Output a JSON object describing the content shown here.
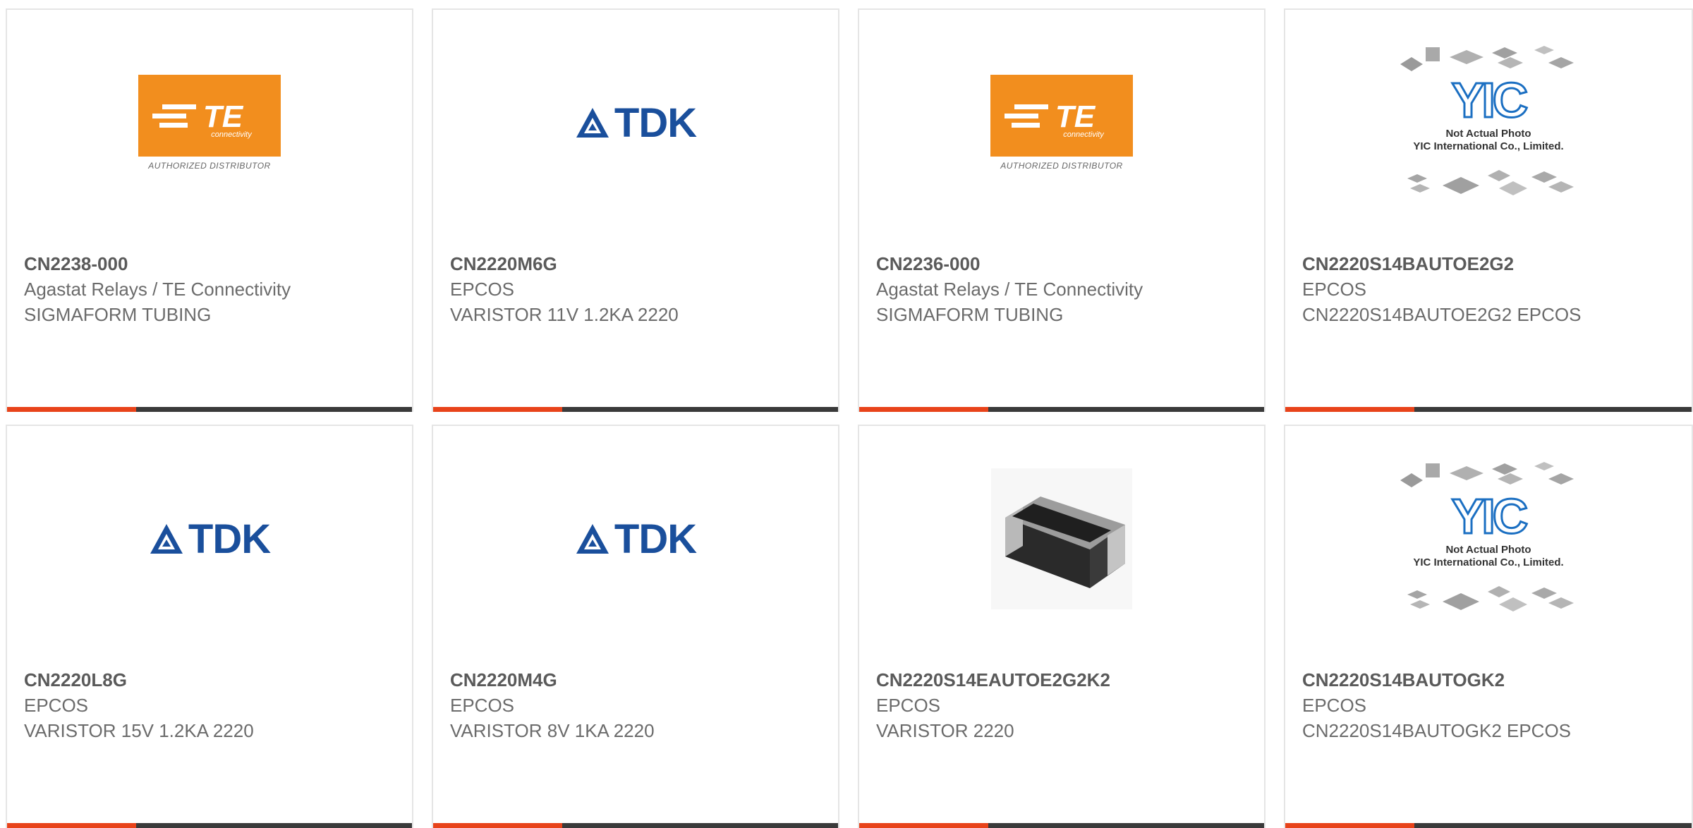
{
  "products": [
    {
      "part_number": "CN2238-000",
      "manufacturer": "Agastat Relays / TE Connectivity",
      "description": "SIGMAFORM TUBING",
      "logo": "te-logo",
      "logo_text": {
        "brand": "TE",
        "sub": "connectivity",
        "caption": "AUTHORIZED DISTRIBUTOR"
      }
    },
    {
      "part_number": "CN2220M6G",
      "manufacturer": "EPCOS",
      "description": "VARISTOR 11V 1.2KA 2220",
      "logo": "tdk-logo",
      "logo_text": {
        "brand": "TDK"
      }
    },
    {
      "part_number": "CN2236-000",
      "manufacturer": "Agastat Relays / TE Connectivity",
      "description": "SIGMAFORM TUBING",
      "logo": "te-logo",
      "logo_text": {
        "brand": "TE",
        "sub": "connectivity",
        "caption": "AUTHORIZED DISTRIBUTOR"
      }
    },
    {
      "part_number": "CN2220S14BAUTOE2G2",
      "manufacturer": "EPCOS",
      "description": "CN2220S14BAUTOE2G2 EPCOS",
      "logo": "yic-placeholder",
      "logo_text": {
        "brand": "YIC",
        "line1": "Not Actual Photo",
        "line2": "YIC International Co., Limited."
      }
    },
    {
      "part_number": "CN2220L8G",
      "manufacturer": "EPCOS",
      "description": "VARISTOR 15V 1.2KA 2220",
      "logo": "tdk-logo",
      "logo_text": {
        "brand": "TDK"
      }
    },
    {
      "part_number": "CN2220M4G",
      "manufacturer": "EPCOS",
      "description": "VARISTOR 8V 1KA 2220",
      "logo": "tdk-logo",
      "logo_text": {
        "brand": "TDK"
      }
    },
    {
      "part_number": "CN2220S14EAUTOE2G2K2",
      "manufacturer": "EPCOS",
      "description": "VARISTOR 2220",
      "logo": "chip-photo",
      "logo_text": {}
    },
    {
      "part_number": "CN2220S14BAUTOGK2",
      "manufacturer": "EPCOS",
      "description": "CN2220S14BAUTOGK2 EPCOS",
      "logo": "yic-placeholder",
      "logo_text": {
        "brand": "YIC",
        "line1": "Not Actual Photo",
        "line2": "YIC International Co., Limited."
      }
    }
  ],
  "colors": {
    "accent": "#e8431a",
    "bar": "#3a3a3a",
    "te_orange": "#f28e1e",
    "tdk_blue": "#1a4f9c",
    "yic_blue": "#1b6fc2"
  }
}
